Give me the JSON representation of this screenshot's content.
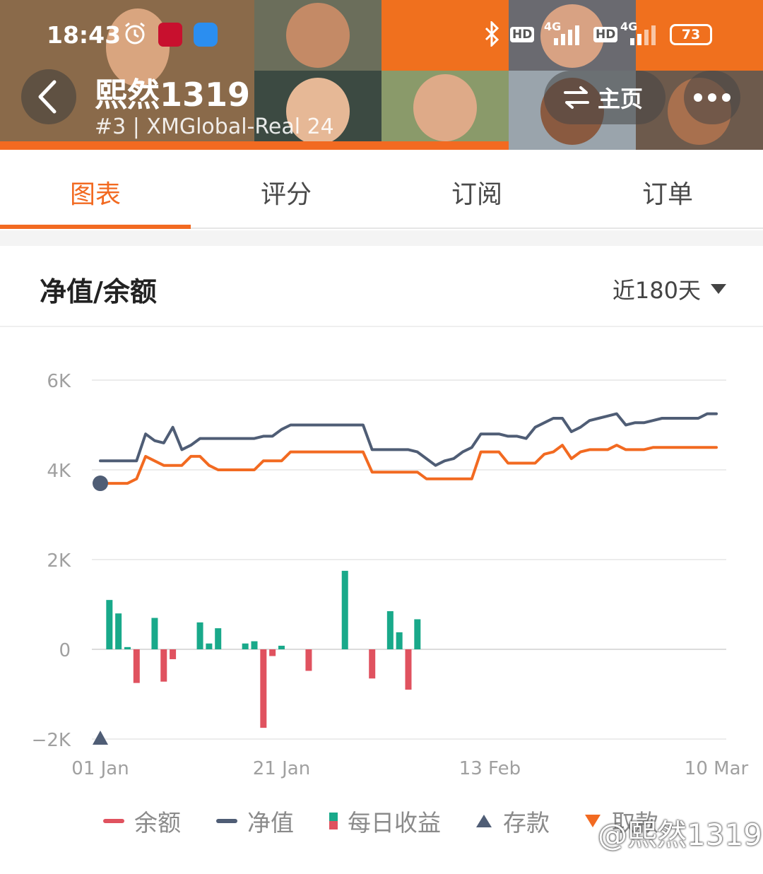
{
  "status_bar": {
    "time": "18:43",
    "battery": "73",
    "network_1": "4G",
    "network_2": "4G",
    "hd_1": "HD",
    "hd_2": "HD",
    "icons": [
      "alarm-icon",
      "news-app-icon",
      "chat-app-icon",
      "bluetooth-icon",
      "signal-icon",
      "battery-icon"
    ]
  },
  "header": {
    "title": "熙然1319",
    "subtitle": "#3 | XMGlobal-Real 24",
    "home_label": "主页",
    "back_icon": "chevron-left-icon",
    "switch_icon": "swap-icon",
    "more_icon": "more-dots-icon"
  },
  "tabs": [
    {
      "label": "图表",
      "active": true
    },
    {
      "label": "评分",
      "active": false
    },
    {
      "label": "订阅",
      "active": false
    },
    {
      "label": "订单",
      "active": false
    }
  ],
  "section": {
    "title": "净值/余额",
    "range_label": "近180天"
  },
  "colors": {
    "accent": "#f26a21",
    "equity": "#4f5d75",
    "profit": "#19a98a",
    "loss": "#e0525f"
  },
  "chart_data": {
    "type": "line",
    "y_ticks": [
      "6K",
      "4K",
      "2K",
      "0",
      "−2K"
    ],
    "y_tick_values": [
      6000,
      4000,
      2000,
      0,
      -2000
    ],
    "ylim": [
      -2000,
      6000
    ],
    "x_ticks": [
      "01 Jan",
      "21 Jan",
      "13 Feb",
      "10 Mar"
    ],
    "x_tick_values": [
      0,
      20,
      43,
      68
    ],
    "xlim": [
      0,
      68
    ],
    "grid": true,
    "series": [
      {
        "name": "余额",
        "type": "line",
        "color": "#f26a21",
        "points": [
          [
            0,
            3700
          ],
          [
            3,
            3700
          ],
          [
            4,
            3800
          ],
          [
            5,
            4300
          ],
          [
            6,
            4200
          ],
          [
            7,
            4100
          ],
          [
            8,
            4100
          ],
          [
            9,
            4100
          ],
          [
            10,
            4300
          ],
          [
            11,
            4300
          ],
          [
            12,
            4100
          ],
          [
            13,
            4000
          ],
          [
            14,
            4000
          ],
          [
            15,
            4000
          ],
          [
            16,
            4000
          ],
          [
            17,
            4000
          ],
          [
            18,
            4200
          ],
          [
            19,
            4200
          ],
          [
            20,
            4200
          ],
          [
            21,
            4400
          ],
          [
            22,
            4400
          ],
          [
            23,
            4400
          ],
          [
            24,
            4400
          ],
          [
            25,
            4400
          ],
          [
            26,
            4400
          ],
          [
            27,
            4400
          ],
          [
            28,
            4400
          ],
          [
            29,
            4400
          ],
          [
            30,
            3950
          ],
          [
            31,
            3950
          ],
          [
            32,
            3950
          ],
          [
            33,
            3950
          ],
          [
            34,
            3950
          ],
          [
            35,
            3950
          ],
          [
            36,
            3800
          ],
          [
            37,
            3800
          ],
          [
            38,
            3800
          ],
          [
            39,
            3800
          ],
          [
            40,
            3800
          ],
          [
            41,
            3800
          ],
          [
            42,
            4400
          ],
          [
            43,
            4400
          ],
          [
            44,
            4400
          ],
          [
            45,
            4150
          ],
          [
            46,
            4150
          ],
          [
            47,
            4150
          ],
          [
            48,
            4150
          ],
          [
            49,
            4350
          ],
          [
            50,
            4400
          ],
          [
            51,
            4550
          ],
          [
            52,
            4250
          ],
          [
            53,
            4400
          ],
          [
            54,
            4450
          ],
          [
            55,
            4450
          ],
          [
            56,
            4450
          ],
          [
            57,
            4550
          ],
          [
            58,
            4450
          ],
          [
            59,
            4450
          ],
          [
            60,
            4450
          ],
          [
            61,
            4500
          ],
          [
            62,
            4500
          ],
          [
            63,
            4500
          ],
          [
            64,
            4500
          ],
          [
            65,
            4500
          ],
          [
            66,
            4500
          ],
          [
            67,
            4500
          ],
          [
            68,
            4500
          ]
        ]
      },
      {
        "name": "净值",
        "type": "line",
        "color": "#4f5d75",
        "points": [
          [
            0,
            4200
          ],
          [
            3,
            4200
          ],
          [
            4,
            4200
          ],
          [
            5,
            4800
          ],
          [
            6,
            4650
          ],
          [
            7,
            4600
          ],
          [
            8,
            4950
          ],
          [
            9,
            4450
          ],
          [
            10,
            4550
          ],
          [
            11,
            4700
          ],
          [
            12,
            4700
          ],
          [
            13,
            4700
          ],
          [
            14,
            4700
          ],
          [
            15,
            4700
          ],
          [
            16,
            4700
          ],
          [
            17,
            4700
          ],
          [
            18,
            4750
          ],
          [
            19,
            4750
          ],
          [
            20,
            4900
          ],
          [
            21,
            5000
          ],
          [
            22,
            5000
          ],
          [
            23,
            5000
          ],
          [
            24,
            5000
          ],
          [
            25,
            5000
          ],
          [
            26,
            5000
          ],
          [
            27,
            5000
          ],
          [
            28,
            5000
          ],
          [
            29,
            5000
          ],
          [
            30,
            4450
          ],
          [
            31,
            4450
          ],
          [
            32,
            4450
          ],
          [
            33,
            4450
          ],
          [
            34,
            4450
          ],
          [
            35,
            4400
          ],
          [
            36,
            4250
          ],
          [
            37,
            4100
          ],
          [
            38,
            4200
          ],
          [
            39,
            4250
          ],
          [
            40,
            4400
          ],
          [
            41,
            4500
          ],
          [
            42,
            4800
          ],
          [
            43,
            4800
          ],
          [
            44,
            4800
          ],
          [
            45,
            4750
          ],
          [
            46,
            4750
          ],
          [
            47,
            4700
          ],
          [
            48,
            4950
          ],
          [
            49,
            5050
          ],
          [
            50,
            5150
          ],
          [
            51,
            5150
          ],
          [
            52,
            4850
          ],
          [
            53,
            4950
          ],
          [
            54,
            5100
          ],
          [
            55,
            5150
          ],
          [
            56,
            5200
          ],
          [
            57,
            5250
          ],
          [
            58,
            5000
          ],
          [
            59,
            5050
          ],
          [
            60,
            5050
          ],
          [
            61,
            5100
          ],
          [
            62,
            5150
          ],
          [
            63,
            5150
          ],
          [
            64,
            5150
          ],
          [
            65,
            5150
          ],
          [
            66,
            5150
          ],
          [
            67,
            5250
          ],
          [
            68,
            5250
          ]
        ]
      },
      {
        "name": "每日收益",
        "type": "bar",
        "points": [
          [
            1,
            1100
          ],
          [
            2,
            800
          ],
          [
            3,
            50
          ],
          [
            4,
            -750
          ],
          [
            6,
            700
          ],
          [
            7,
            -720
          ],
          [
            8,
            -220
          ],
          [
            11,
            600
          ],
          [
            12,
            130
          ],
          [
            13,
            470
          ],
          [
            16,
            130
          ],
          [
            17,
            180
          ],
          [
            18,
            -1750
          ],
          [
            19,
            -150
          ],
          [
            20,
            80
          ],
          [
            23,
            -480
          ],
          [
            27,
            1750
          ],
          [
            30,
            -650
          ],
          [
            32,
            850
          ],
          [
            33,
            380
          ],
          [
            34,
            -900
          ],
          [
            35,
            670
          ]
        ]
      }
    ],
    "markers": [
      {
        "name": "存款",
        "x": 0,
        "y": -2000,
        "shape": "triangle-up"
      }
    ],
    "start_point": {
      "x": 0,
      "y": 3700
    }
  },
  "legend": [
    {
      "label": "余额",
      "kind": "line",
      "color": "#e0525f"
    },
    {
      "label": "净值",
      "kind": "line",
      "color": "#4f5d75"
    },
    {
      "label": "每日收益",
      "kind": "bars"
    },
    {
      "label": "存款",
      "kind": "triangle-up"
    },
    {
      "label": "取款",
      "kind": "triangle-down"
    }
  ],
  "watermark": "@熙然1319"
}
